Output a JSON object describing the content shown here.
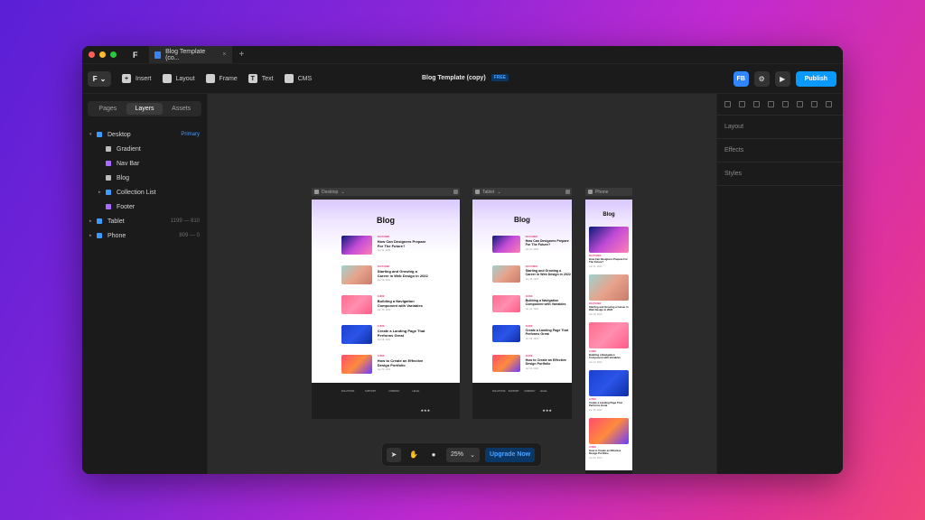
{
  "tab": {
    "title": "Blog Template (co...",
    "close": "×",
    "add": "+"
  },
  "logo": {
    "glyph": "F"
  },
  "toolbar": {
    "menu_glyph": "F",
    "menu_caret": "⌄",
    "insert": "Insert",
    "layout": "Layout",
    "frame": "Frame",
    "text": "Text",
    "cms": "CMS",
    "text_glyph": "T",
    "doc_title": "Blog Template (copy)",
    "doc_badge": "FREE",
    "avatar": "FB",
    "settings_glyph": "⚙",
    "play_glyph": "▶",
    "publish": "Publish"
  },
  "left_panel": {
    "tabs": [
      "Pages",
      "Layers",
      "Assets"
    ],
    "active_tab": "Layers",
    "layers": [
      {
        "name": "Desktop",
        "meta": "Primary",
        "level": 0,
        "caret": "▾",
        "icon_color": "#3d9bff"
      },
      {
        "name": "Gradient",
        "meta": "",
        "level": 1,
        "caret": "",
        "icon_color": "#bdbdbd"
      },
      {
        "name": "Nav Bar",
        "meta": "",
        "level": 1,
        "caret": "",
        "icon_color": "#a86bff"
      },
      {
        "name": "Blog",
        "meta": "",
        "level": 1,
        "caret": "",
        "icon_color": "#bdbdbd"
      },
      {
        "name": "Collection List",
        "meta": "",
        "level": 1,
        "caret": "▸",
        "icon_color": "#3d9bff"
      },
      {
        "name": "Footer",
        "meta": "",
        "level": 1,
        "caret": "",
        "icon_color": "#a86bff"
      },
      {
        "name": "Tablet",
        "meta": "1199 — 810",
        "level": 0,
        "caret": "▸",
        "icon_color": "#3d9bff"
      },
      {
        "name": "Phone",
        "meta": "809 — 0",
        "level": 0,
        "caret": "▸",
        "icon_color": "#3d9bff"
      }
    ]
  },
  "right_panel": {
    "sections": [
      "Layout",
      "Effects",
      "Styles"
    ]
  },
  "canvas": {
    "frames": [
      {
        "label": "Desktop",
        "caret": "⌄"
      },
      {
        "label": "Tablet",
        "caret": "⌄"
      },
      {
        "label": "Phone",
        "caret": ""
      }
    ],
    "blog_title": "Blog",
    "posts": [
      {
        "category": "FEATURED",
        "title": "How Can Designers Prepare For The Future?",
        "date": "Jan 21, 2022",
        "colors": [
          "#0a1a7a",
          "#c24bd6",
          "#ff7fb6"
        ]
      },
      {
        "category": "FEATURED",
        "title": "Starting and Growing a Career in Web Design in 2022",
        "date": "Jan 18, 2022",
        "colors": [
          "#9fd2cf",
          "#e7a38c",
          "#c97d6a"
        ]
      },
      {
        "category": "GUIDE",
        "title": "Building a Navigation Component with Variables",
        "date": "Jan 12, 2022",
        "colors": [
          "#ff6b8f",
          "#ff8fb0",
          "#ff5c88"
        ]
      },
      {
        "category": "GUIDE",
        "title": "Create a Landing Page That Performs Great",
        "date": "Jan 08, 2022",
        "colors": [
          "#1d3fcf",
          "#2a55e8",
          "#0f2ea8"
        ]
      },
      {
        "category": "GUIDE",
        "title": "How to Create an Effective Design Portfolio",
        "date": "Jan 02, 2022",
        "colors": [
          "#ff4d6d",
          "#ff8a3d",
          "#6b3cff"
        ]
      }
    ],
    "footer": {
      "columns": [
        "SOLUTIONS",
        "SUPPORT",
        "COMPANY",
        "LEGAL"
      ],
      "stars": "★★★"
    }
  },
  "bottom_bar": {
    "select_glyph": "➤",
    "hand_glyph": "✋",
    "comment_glyph": "●",
    "zoom": "25%",
    "zoom_caret": "⌄",
    "upgrade": "Upgrade Now"
  }
}
